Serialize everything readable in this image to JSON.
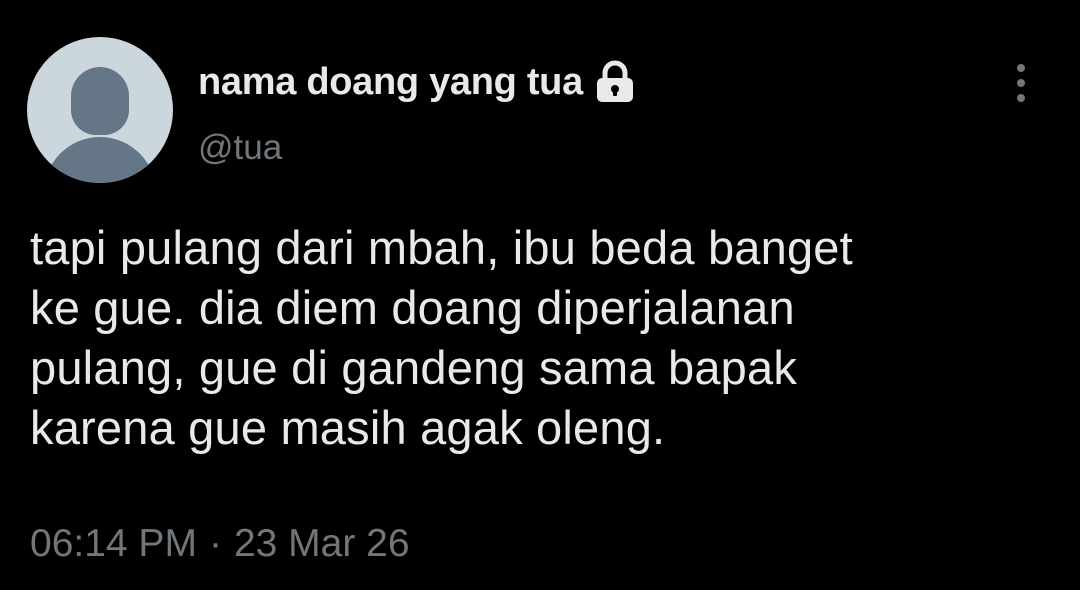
{
  "user": {
    "display_name": "nama doang yang tua",
    "handle": "@tua",
    "protected_icon": "lock-icon",
    "avatar": "default-avatar"
  },
  "tweet": {
    "lines": [
      "tapi pulang dari mbah, ibu beda banget",
      "ke gue. dia diem doang diperjalanan",
      "pulang, gue di gandeng sama bapak",
      "karena gue masih agak oleng."
    ]
  },
  "meta": {
    "time": "06:14 PM",
    "separator": "·",
    "date": "23 Mar 26"
  },
  "menu": {
    "icon": "more-vertical-icon"
  },
  "colors": {
    "background": "#000000",
    "primary_text": "#e7e9ea",
    "secondary_text": "#71767b",
    "avatar_bg": "#ccd6dd",
    "avatar_fg": "#657786"
  }
}
